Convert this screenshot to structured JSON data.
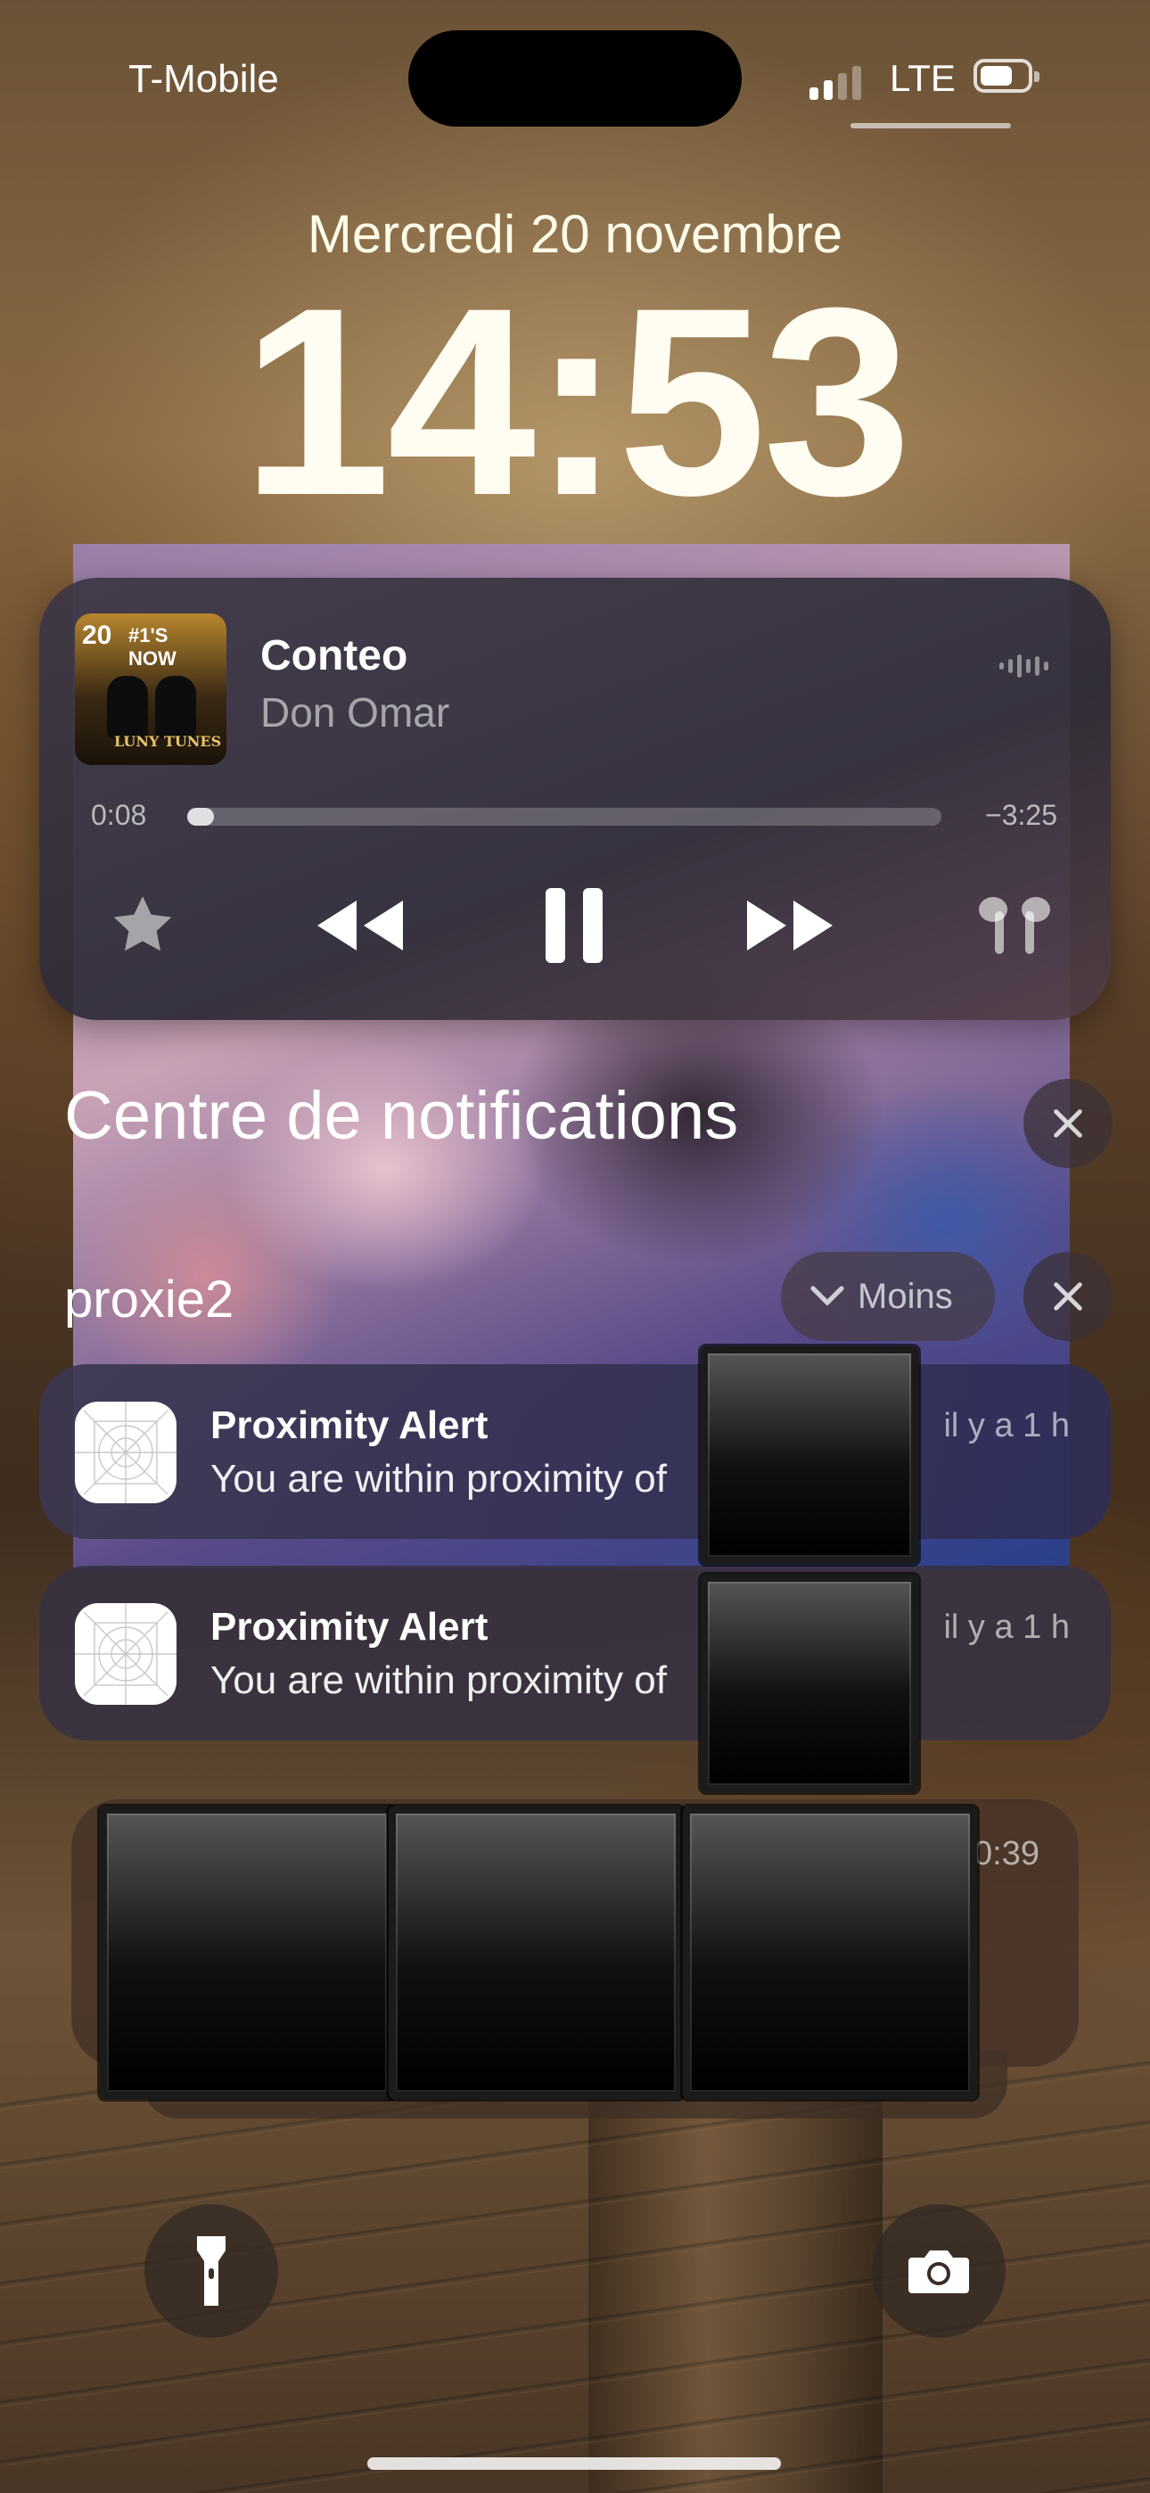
{
  "status_bar": {
    "carrier": "T-Mobile",
    "network": "LTE",
    "signal_bars": 2,
    "signal_total": 4,
    "battery_level": 0.7
  },
  "lock_screen": {
    "date": "Mercredi 20 novembre",
    "time": "14:53"
  },
  "now_playing": {
    "song": "Conteo",
    "artist": "Don Omar",
    "album_art_text": [
      "20",
      "#1'S NOW",
      "LUNY TUNES"
    ],
    "elapsed": "0:08",
    "remaining": "−3:25",
    "progress": 0.02,
    "controls": [
      "star-icon",
      "rewind-icon",
      "pause-icon",
      "fast-forward-icon",
      "airpods-icon"
    ]
  },
  "notification_center": {
    "title": "Centre de notifications",
    "group": {
      "app_name": "proxie2",
      "collapse_label": "Moins",
      "notifications": [
        {
          "title": "Proximity Alert",
          "body": "You are within proximity of",
          "time": "il y a 1 h"
        },
        {
          "title": "Proximity Alert",
          "body": "You are within proximity of",
          "time": "il y a 1 h"
        }
      ]
    },
    "stack": {
      "time": "0:39"
    }
  },
  "quick_actions": [
    "flashlight-icon",
    "camera-icon"
  ],
  "colors": {
    "player_bg": "#3c3746",
    "notif_bg": "#373241",
    "text_secondary": "rgba(255,255,255,0.6)"
  }
}
